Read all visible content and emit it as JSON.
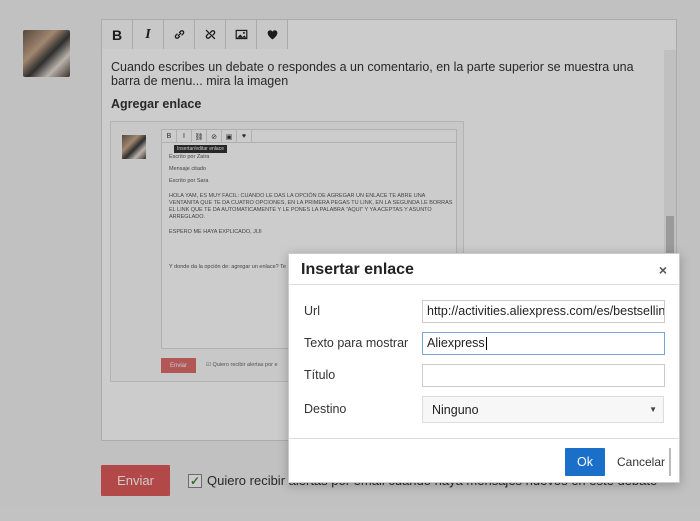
{
  "toolbar": {
    "bold_label": "B",
    "italic_label": "I"
  },
  "post": {
    "text": "Cuando escribes un debate o respondes a un comentario, en la parte superior se muestra una barra de menu... mira la imagen",
    "heading": "Agregar enlace"
  },
  "embedded": {
    "tooltip": "Insertar/editar enlace",
    "lines": [
      "Escrito por Zaira",
      "Mensaje citado",
      "Escrito por Sara",
      "HOLA YAM, ES MUY FACIL: CUANDO LE DAS LA OPCIÓN DE AGREGAR UN ENLACE TE ABRE UNA VENTANITA QUE TE DA CUATRO OPCIONES, EN LA PRIMERA PEGAS TU LINK, EN LA SEGUNDA LE BORRAS EL LINK QUE TE DA AUTOMATICAMENTE Y LE PONES LA PALABRA \"AQUI\" Y YA ACEPTAS Y ASUNTO ARREGLADO.",
      "ESPERO ME HAYA EXPLICADO, JIJI",
      "Y donde da la opción de: agregar un enlace? Te"
    ],
    "send_label": "Enviar",
    "notify_label": "Quiero recibir alertas por e"
  },
  "footer": {
    "send_label": "Enviar",
    "notify_label": "Quiero recibir alertas por email cuando haya mensajes nuevos en este debate",
    "notify_checked": true
  },
  "dialog": {
    "title": "Insertar enlace",
    "close_label": "×",
    "fields": {
      "url_label": "Url",
      "url_value": "http://activities.aliexpress.com/es/bestselling-pro",
      "text_label": "Texto para mostrar",
      "text_value": "Aliexpress",
      "title_label": "Título",
      "title_value": "",
      "target_label": "Destino",
      "target_value": "Ninguno"
    },
    "ok_label": "Ok",
    "cancel_label": "Cancelar"
  },
  "icons": [
    "link-icon",
    "unlink-icon",
    "image-icon",
    "heart-icon",
    "close-icon",
    "chevron-down-icon",
    "checkmark-icon"
  ],
  "colors": {
    "send_button": "#e05a5a",
    "ok_button": "#1a6fc9"
  }
}
